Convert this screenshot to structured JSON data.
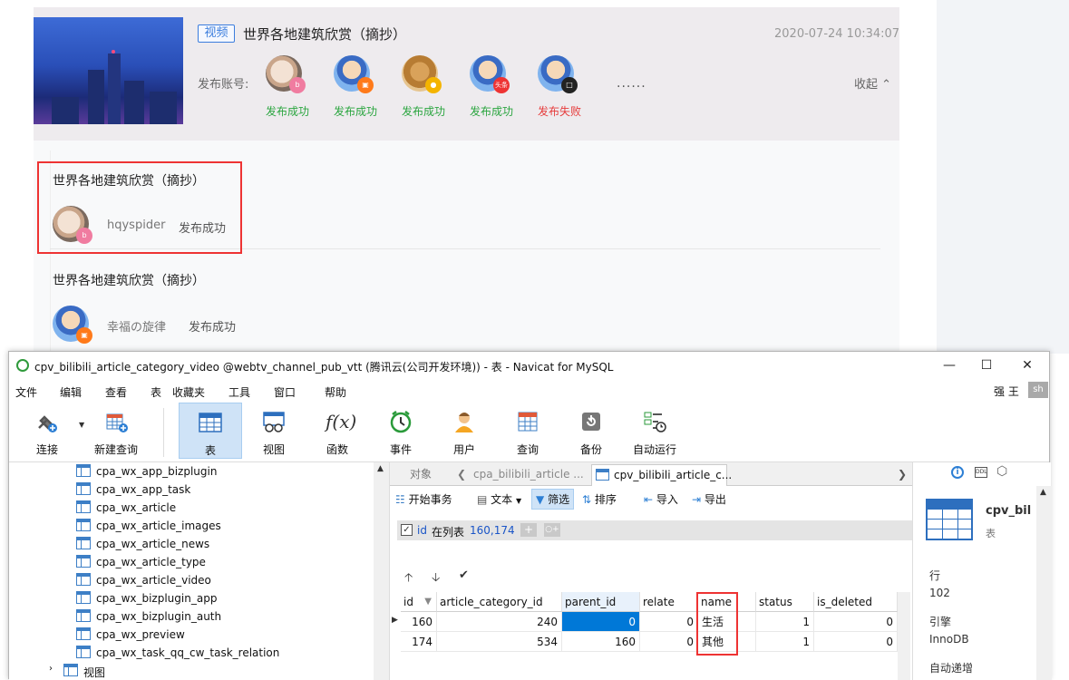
{
  "web": {
    "card": {
      "tag": "视频",
      "title": "世界各地建筑欣赏（摘抄）",
      "time": "2020-07-24 10:34:07",
      "publish_label": "发布账号:",
      "accounts": [
        {
          "status": "发布成功",
          "kind": "ok",
          "badge": "bilibili",
          "badge_color": "#f07ca0"
        },
        {
          "status": "发布成功",
          "kind": "ok",
          "badge": "",
          "badge_color": "#ff7a1a"
        },
        {
          "status": "发布成功",
          "kind": "ok",
          "badge": "",
          "badge_color": "#f4b400"
        },
        {
          "status": "发布成功",
          "kind": "ok",
          "badge": "头条",
          "badge_color": "#e33"
        },
        {
          "status": "发布失败",
          "kind": "fail",
          "badge": "",
          "badge_color": "#222"
        }
      ],
      "more": "......",
      "collapse": "收起"
    },
    "items": [
      {
        "title": "世界各地建筑欣赏（摘抄）",
        "name": "hqyspider",
        "status": "发布成功"
      },
      {
        "title": "世界各地建筑欣赏（摘抄）",
        "name": "幸福の旋律",
        "status": "发布成功"
      }
    ]
  },
  "navicat": {
    "title": "cpv_bilibili_article_category_video @webtv_channel_pub_vtt (腾讯云(公司开发环境)) - 表 - Navicat for MySQL",
    "menu": [
      "文件",
      "编辑",
      "查看",
      "表",
      "收藏夹",
      "工具",
      "窗口",
      "帮助"
    ],
    "user_name": "强 王",
    "user_avatar": "sh",
    "toolbar": [
      "连接",
      "新建查询",
      "表",
      "视图",
      "函数",
      "事件",
      "用户",
      "查询",
      "备份",
      "自动运行"
    ],
    "tree_items": [
      "cpa_wx_app_bizplugin",
      "cpa_wx_app_task",
      "cpa_wx_article",
      "cpa_wx_article_images",
      "cpa_wx_article_news",
      "cpa_wx_article_type",
      "cpa_wx_article_video",
      "cpa_wx_bizplugin_app",
      "cpa_wx_bizplugin_auth",
      "cpa_wx_preview",
      "cpa_wx_task_qq_cw_task_relation"
    ],
    "tree_views": "视图",
    "tabs": [
      "对象",
      "cpa_bilibili_article ...",
      "cpv_bilibili_article_c..."
    ],
    "subtoolbar": [
      "开始事务",
      "文本",
      "筛选",
      "排序",
      "导入",
      "导出"
    ],
    "filter": {
      "field": "id",
      "op": "在列表",
      "values": "160,174"
    },
    "grid": {
      "columns": [
        "id",
        "article_category_id",
        "parent_id",
        "relate",
        "name",
        "status",
        "is_deleted"
      ],
      "rows": [
        [
          "160",
          "240",
          "0",
          "0",
          "生活",
          "1",
          "0"
        ],
        [
          "174",
          "534",
          "160",
          "0",
          "其他",
          "1",
          "0"
        ]
      ]
    },
    "info": {
      "name": "cpv_bil",
      "type": "表",
      "rows_label": "行",
      "rows_value": "102",
      "engine_label": "引擎",
      "engine_value": "InnoDB",
      "auto_inc_label": "自动递增"
    }
  }
}
